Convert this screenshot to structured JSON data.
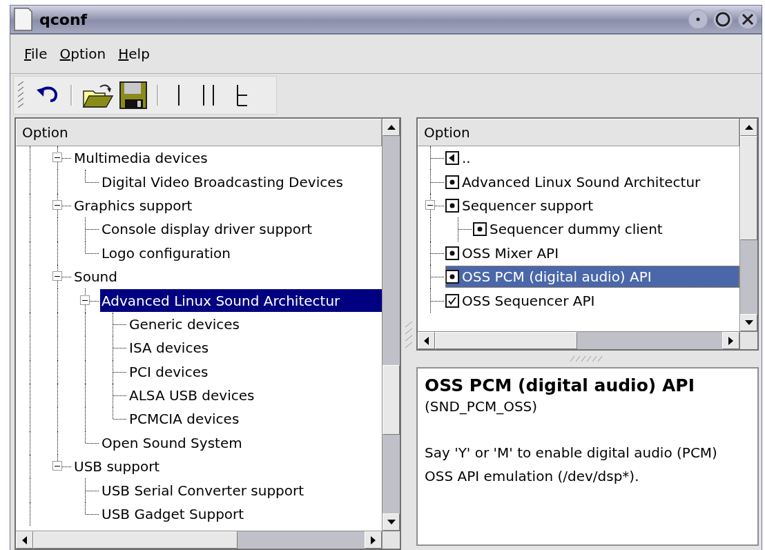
{
  "window": {
    "title": "qconf"
  },
  "menu": [
    {
      "label": "File"
    },
    {
      "label": "Option"
    },
    {
      "label": "Help"
    }
  ],
  "left_tree": {
    "header": "Option",
    "items": [
      {
        "label": "Multimedia devices",
        "expanded": true,
        "selected": false,
        "children": [
          {
            "label": "Digital Video Broadcasting Devices",
            "selected": false
          }
        ]
      },
      {
        "label": "Graphics support",
        "expanded": true,
        "selected": false,
        "children": [
          {
            "label": "Console display driver support",
            "selected": false
          },
          {
            "label": "Logo configuration",
            "selected": false
          }
        ]
      },
      {
        "label": "Sound",
        "expanded": true,
        "selected": false,
        "children": [
          {
            "label": "Advanced Linux Sound Architectur",
            "expanded": true,
            "selected": true,
            "children": [
              {
                "label": "Generic devices",
                "selected": false
              },
              {
                "label": "ISA devices",
                "selected": false
              },
              {
                "label": "PCI devices",
                "selected": false
              },
              {
                "label": "ALSA USB devices",
                "selected": false
              },
              {
                "label": "PCMCIA devices",
                "selected": false
              }
            ]
          },
          {
            "label": "Open Sound System",
            "selected": false
          }
        ]
      },
      {
        "label": "USB support",
        "expanded": true,
        "selected": false,
        "children": [
          {
            "label": "USB Serial Converter support",
            "selected": false
          },
          {
            "label": "USB Gadget Support",
            "selected": false
          }
        ]
      }
    ]
  },
  "right_tree": {
    "header": "Option",
    "items": [
      {
        "label": "..",
        "kind": "back",
        "selected": false
      },
      {
        "label": "Advanced Linux Sound Architectur",
        "kind": "module",
        "selected": false
      },
      {
        "label": "Sequencer support",
        "kind": "module",
        "expanded": true,
        "selected": false,
        "children": [
          {
            "label": "Sequencer dummy client",
            "kind": "module",
            "selected": false
          }
        ]
      },
      {
        "label": "OSS Mixer API",
        "kind": "module",
        "selected": false
      },
      {
        "label": "OSS PCM (digital audio) API",
        "kind": "module",
        "selected": true
      },
      {
        "label": "OSS Sequencer API",
        "kind": "yes",
        "selected": false
      }
    ]
  },
  "info": {
    "title": "OSS PCM (digital audio) API",
    "symbol": "(SND_PCM_OSS)",
    "description": "Say 'Y' or 'M' to enable digital audio (PCM) OSS API emulation (/dev/dsp*)."
  }
}
